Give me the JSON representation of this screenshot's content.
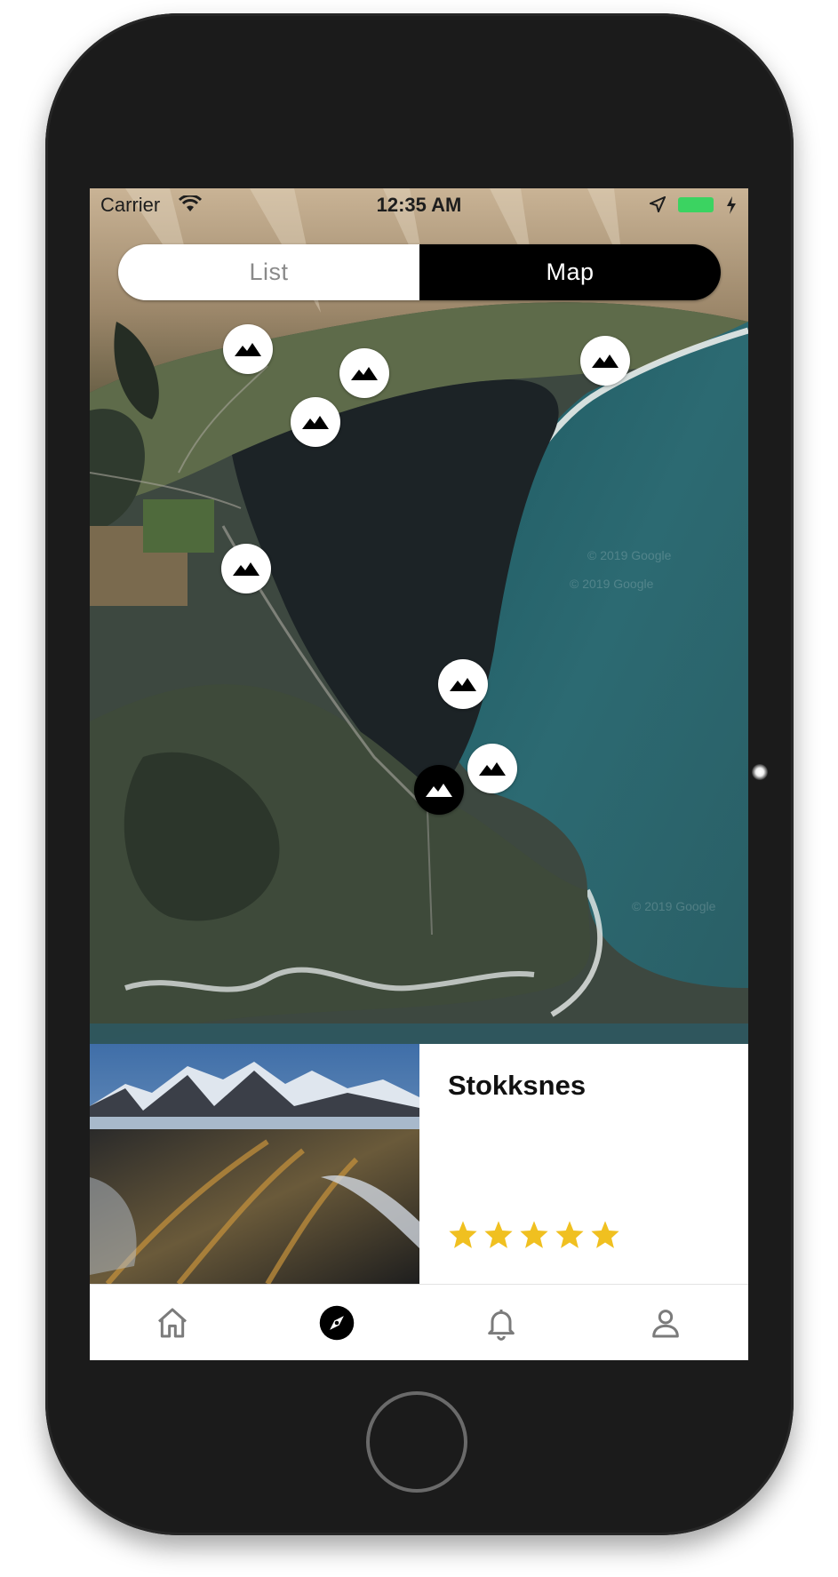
{
  "status_bar": {
    "carrier": "Carrier",
    "time": "12:35 AM",
    "battery_color": "#3bd361"
  },
  "segmented_control": {
    "options": [
      "List",
      "Map"
    ],
    "selected": "Map"
  },
  "map": {
    "type": "satellite",
    "marker_icon": "mountain-icon",
    "marker_count": 8,
    "active_marker_color": "#000000",
    "watermark": "© 2019 Google"
  },
  "place_card": {
    "title": "Stokksnes",
    "rating": 5,
    "rating_max": 5,
    "star_color": "#f0c020"
  },
  "tab_bar": {
    "tabs": [
      "home-icon",
      "compass-icon",
      "bell-icon",
      "profile-icon"
    ],
    "active": "compass-icon"
  }
}
